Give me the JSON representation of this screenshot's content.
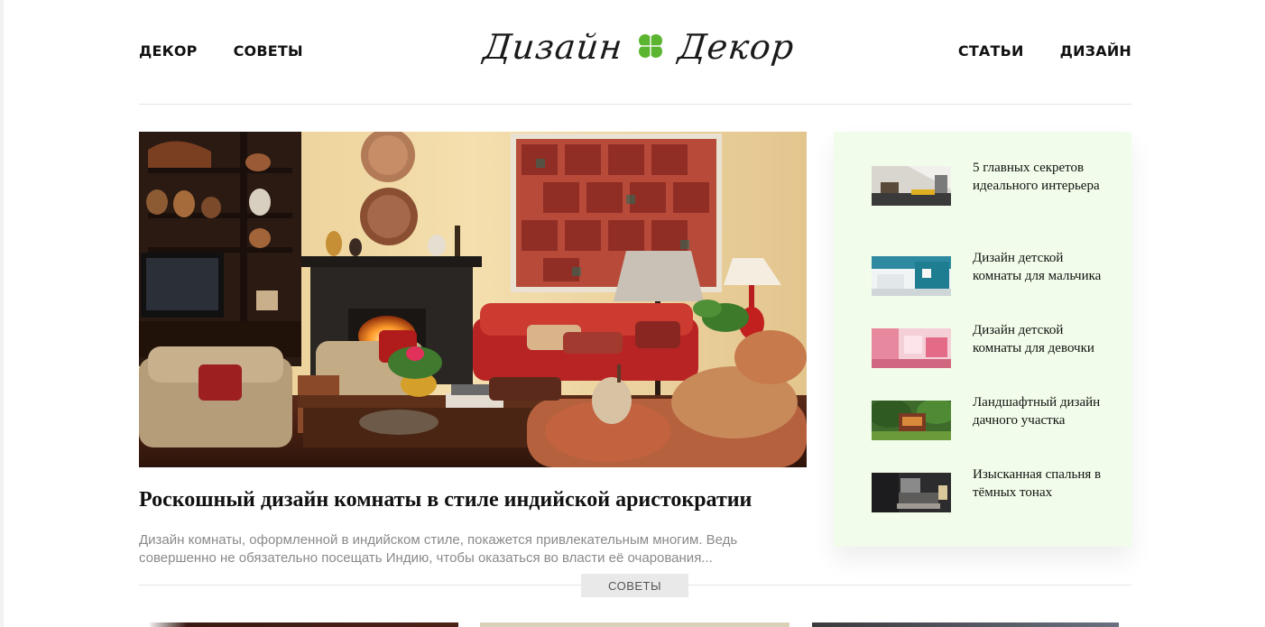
{
  "header": {
    "nav_left": [
      "ДЕКОР",
      "СОВЕТЫ"
    ],
    "nav_right": [
      "СТАТЬИ",
      "ДИЗАЙН"
    ],
    "logo_left": "Дизайн",
    "logo_right": "Декор",
    "logo_icon": "clover-icon"
  },
  "featured": {
    "title": "Роскошный дизайн комнаты в стиле индийской аристократии",
    "excerpt": "Дизайн комнаты, оформленной в индийском стиле, покажется привлекательным многим. Ведь совершенно не обязательно посещать Индию, чтобы оказаться во власти её очарования...",
    "category": "СОВЕТЫ"
  },
  "sidebar": {
    "items": [
      {
        "title": "5 главных секретов идеального интерьера"
      },
      {
        "title": "Дизайн детской комнаты для мальчика"
      },
      {
        "title": "Дизайн детской комнаты для девочки"
      },
      {
        "title": "Ландшафтный дизайн дачного участка"
      },
      {
        "title": "Изысканная спальня в тёмных тонах"
      }
    ]
  },
  "colors": {
    "sidebar_bg": "#f1fdea",
    "clover_green": "#5cb531",
    "text": "#111111",
    "excerpt": "#8a8a8a"
  }
}
